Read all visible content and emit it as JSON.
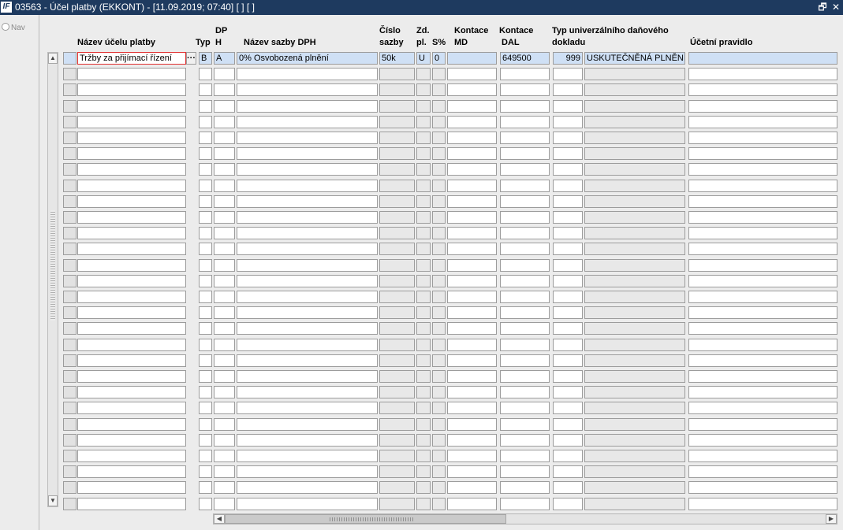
{
  "window": {
    "title": "03563 - Účel platby (EKKONT) - [11.09.2019; 07:40]  [ ]  [ ]",
    "logo": "IF",
    "restore_glyph": "🗗",
    "close_glyph": "✕"
  },
  "nav": {
    "label": "Nav"
  },
  "headers": {
    "nazev_ucelu": "Název účelu platby",
    "typ": "Typ",
    "dph_1": "DP",
    "dph_2": "H",
    "nazev_sazby": "Název sazby DPH",
    "cislo_1": "Číslo",
    "cislo_2": "sazby",
    "zd_1": "Zd.",
    "zd_2": "pl.",
    "s_pct": "S%",
    "kmd_1": "Kontace",
    "kmd_2": "MD",
    "kdal_1": "Kontace",
    "kdal_2": "DAL",
    "typdok_1": "Typ univerzálního daňového",
    "typdok_2": "dokladu",
    "ucetni": "Účetní pravidlo"
  },
  "lov_button": "···",
  "rows": [
    {
      "nazev": "Tržby za přijímací řízení",
      "typ": "B",
      "dph": "A",
      "nazev_sazby": "0% Osvobozená plnění",
      "cislo_sazby": "50k",
      "zd_pl": "U",
      "s_pct": "0",
      "kontace_md": "",
      "kontace_dal": "649500",
      "typ_kod": "999",
      "typ_nazev": "USKUTEČNĚNÁ PLNĚNÍ Z",
      "ucetni": ""
    }
  ],
  "empty_row_count": 28,
  "scroll": {
    "up_glyph": "▲",
    "down_glyph": "▼",
    "left_glyph": "◀",
    "right_glyph": "▶"
  }
}
